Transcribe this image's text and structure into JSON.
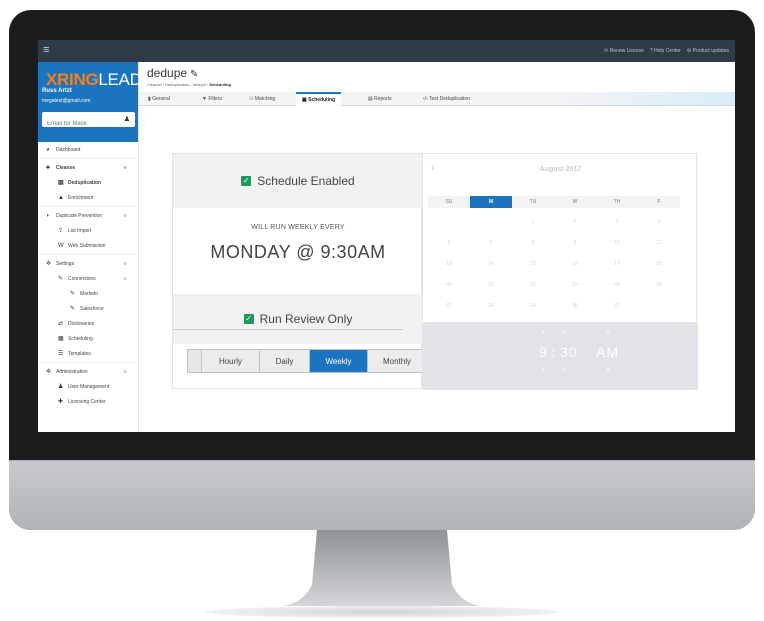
{
  "topbar": {
    "menu_icon": "hamburger-icon",
    "links": [
      "Renew License",
      "Help Center",
      "Product updates"
    ]
  },
  "sidebar": {
    "logo_x": "X",
    "logo_ring": "RING",
    "logo_lead": "LEAD",
    "user_name": "Russ Artzt",
    "user_email": "megatest@gmail.com",
    "mask_placeholder": "Email for Mask",
    "items": [
      {
        "label": "Dashboard"
      },
      {
        "label": "Cleanse"
      },
      {
        "label": "Deduplication"
      },
      {
        "label": "Enrichment"
      },
      {
        "label": "Duplicate Prevention"
      },
      {
        "label": "List Import"
      },
      {
        "label": "Web Submission"
      },
      {
        "label": "Settings"
      },
      {
        "label": "Connections"
      },
      {
        "label": "Marketo"
      },
      {
        "label": "Salesforce"
      },
      {
        "label": "Dictionaries"
      },
      {
        "label": "Scheduling"
      },
      {
        "label": "Templates"
      },
      {
        "label": "Administration"
      },
      {
        "label": "User Management"
      },
      {
        "label": "Licensing Center"
      }
    ]
  },
  "main": {
    "title": "dedupe",
    "breadcrumb": {
      "a": "Cleanse",
      "b": "Deduplication",
      "c": "dedupe",
      "d": "Scheduling"
    },
    "tabs": [
      "General",
      "Filters",
      "Matching",
      "Scheduling",
      "Reports",
      "Test Deduplication"
    ],
    "active_tab": "Scheduling"
  },
  "schedule": {
    "enabled_label": "Schedule Enabled",
    "will_run": "WILL RUN WEEKLY EVERY",
    "when": "MONDAY @ 9:30AM",
    "review_label": "Run Review Only",
    "freq": [
      "Hourly",
      "Daily",
      "Weekly",
      "Monthly"
    ],
    "freq_selected": "Weekly"
  },
  "calendar": {
    "month": "August 2017",
    "dow": [
      "SU",
      "M",
      "TU",
      "W",
      "TH",
      "F"
    ],
    "dow_selected": "M",
    "weeks": [
      [
        "",
        "",
        "1",
        "2",
        "3",
        "4"
      ],
      [
        "6",
        "7",
        "8",
        "9",
        "10",
        "11"
      ],
      [
        "13",
        "14",
        "15",
        "16",
        "17",
        "18"
      ],
      [
        "20",
        "21",
        "22",
        "23",
        "24",
        "25"
      ],
      [
        "27",
        "28",
        "29",
        "30",
        "31",
        ""
      ]
    ],
    "time_hour": "9",
    "time_colon": ":",
    "time_minute": "30",
    "time_ampm": "AM"
  }
}
